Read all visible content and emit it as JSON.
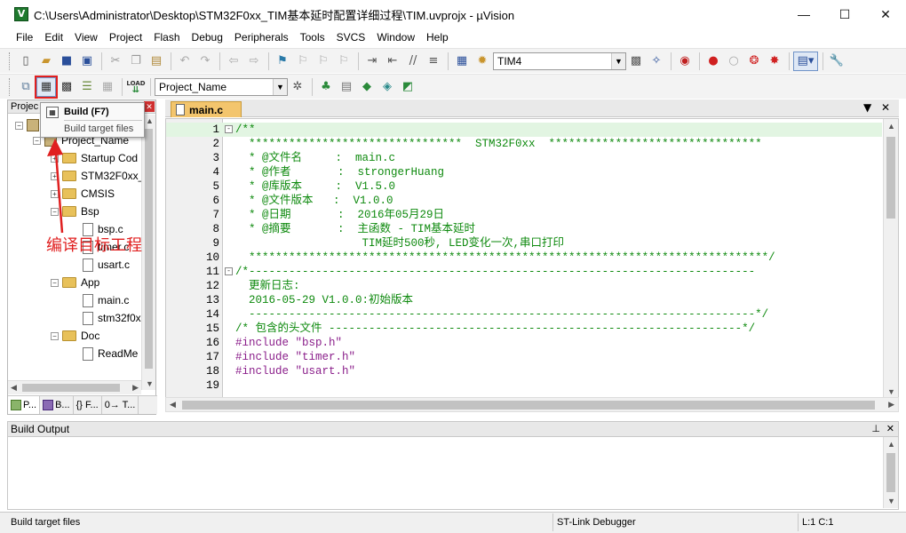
{
  "window": {
    "title": "C:\\Users\\Administrator\\Desktop\\STM32F0xx_TIM基本延时配置详细过程\\TIM.uvprojx - µVision",
    "minimize_glyph": "—",
    "maximize_glyph": "☐",
    "close_glyph": "✕"
  },
  "menu": [
    "File",
    "Edit",
    "View",
    "Project",
    "Flash",
    "Debug",
    "Peripherals",
    "Tools",
    "SVCS",
    "Window",
    "Help"
  ],
  "toolbar": {
    "target_combo_value": "TIM4",
    "project_combo_value": "Project_Name",
    "load_label": "LOAD"
  },
  "tooltip": {
    "title": "Build (F7)",
    "description": "Build target files"
  },
  "annotation": {
    "text": "编译目标工程",
    "color": "#e02020"
  },
  "project_pane": {
    "title": "Projec",
    "tree": [
      {
        "label": "Project_Name",
        "type": "project",
        "depth": 1
      },
      {
        "label": "Startup Cod",
        "type": "folder",
        "depth": 2
      },
      {
        "label": "STM32F0xx_",
        "type": "folder",
        "depth": 2
      },
      {
        "label": "CMSIS",
        "type": "folder",
        "depth": 2
      },
      {
        "label": "Bsp",
        "type": "folder",
        "depth": 2
      },
      {
        "label": "bsp.c",
        "type": "file",
        "depth": 3
      },
      {
        "label": "timer.c",
        "type": "file",
        "depth": 3
      },
      {
        "label": "usart.c",
        "type": "file",
        "depth": 3
      },
      {
        "label": "App",
        "type": "folder",
        "depth": 2
      },
      {
        "label": "main.c",
        "type": "file",
        "depth": 3
      },
      {
        "label": "stm32f0x",
        "type": "file",
        "depth": 3
      },
      {
        "label": "Doc",
        "type": "folder",
        "depth": 2
      },
      {
        "label": "ReadMe",
        "type": "file",
        "depth": 3
      }
    ],
    "tabs": [
      "P...",
      "B...",
      "{} F...",
      "0→ T..."
    ]
  },
  "editor": {
    "tab_label": "main.c",
    "lines": [
      {
        "n": "1",
        "text": "/**",
        "fold": "-",
        "hl": true
      },
      {
        "n": "2",
        "text": "  ********************************  STM32F0xx  ********************************",
        "fold": ""
      },
      {
        "n": "3",
        "text": "  * @文件名     :  main.c",
        "fold": ""
      },
      {
        "n": "4",
        "text": "  * @作者       :  strongerHuang",
        "fold": ""
      },
      {
        "n": "5",
        "text": "  * @库版本     :  V1.5.0",
        "fold": ""
      },
      {
        "n": "6",
        "text": "  * @文件版本   :  V1.0.0",
        "fold": ""
      },
      {
        "n": "7",
        "text": "  * @日期       :  2016年05月29日",
        "fold": ""
      },
      {
        "n": "8",
        "text": "  * @摘要       :  主函数 - TIM基本延时",
        "fold": ""
      },
      {
        "n": "9",
        "text": "                   TIM延时500秒, LED变化一次,串口打印",
        "fold": ""
      },
      {
        "n": "10",
        "text": "  ******************************************************************************/",
        "fold": ""
      },
      {
        "n": "11",
        "text": "/*----------------------------------------------------------------------------",
        "fold": "-"
      },
      {
        "n": "12",
        "text": "  更新日志:",
        "fold": ""
      },
      {
        "n": "13",
        "text": "  2016-05-29 V1.0.0:初始版本",
        "fold": ""
      },
      {
        "n": "14",
        "text": "  ----------------------------------------------------------------------------*/",
        "fold": ""
      },
      {
        "n": "15",
        "text": "/* 包含的头文件 --------------------------------------------------------------*/",
        "fold": ""
      },
      {
        "n": "16",
        "text": "#include \"bsp.h\"",
        "fold": "",
        "kind": "include"
      },
      {
        "n": "17",
        "text": "#include \"timer.h\"",
        "fold": "",
        "kind": "include"
      },
      {
        "n": "18",
        "text": "#include \"usart.h\"",
        "fold": "",
        "kind": "include"
      },
      {
        "n": "19",
        "text": "",
        "fold": ""
      }
    ]
  },
  "build_output": {
    "title": "Build Output"
  },
  "statusbar": {
    "left": "Build target files",
    "debugger": "ST-Link Debugger",
    "position": "L:1 C:1"
  }
}
